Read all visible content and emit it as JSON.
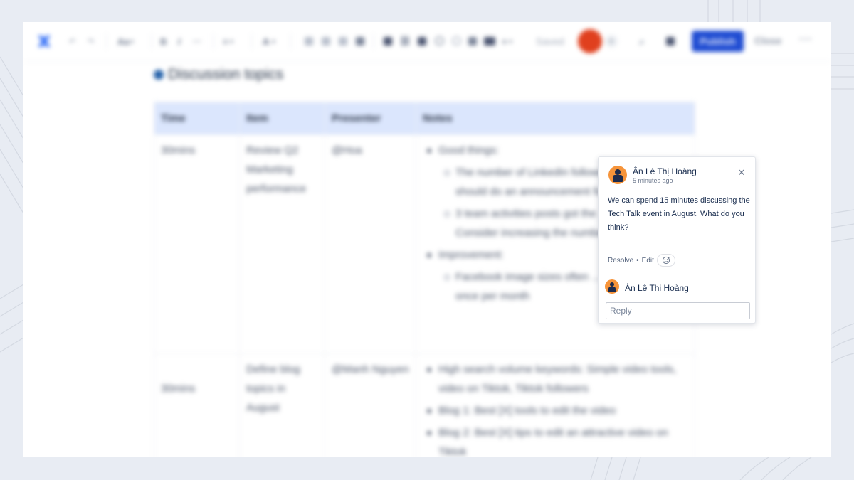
{
  "colors": {
    "brand": "#2f6cf6",
    "publish": "#1e4bd2",
    "header_row": "#dbe6fd",
    "avatar": "#f6943a",
    "presence_avatar": "#e0401e"
  },
  "toolbar": {
    "undo_redo_icons": [
      "undo-icon",
      "redo-icon"
    ],
    "text_style_label": "Aa",
    "format_icons": [
      "bold-icon",
      "italic-icon",
      "more-format-icon"
    ],
    "align_icon": "align-icon",
    "text_color_icon": "text-color-icon",
    "list_icons": [
      "bullet-list-icon",
      "numbered-list-icon",
      "task-list-icon",
      "indent-icon"
    ],
    "insert_icons": [
      "table-icon",
      "link-icon",
      "image-icon",
      "mention-icon",
      "emoji-icon",
      "layout-icon",
      "columns-icon",
      "insert-more-icon"
    ],
    "saved_label": "Saved",
    "add_collaborator": "+",
    "publish_label": "Publish",
    "close_label": "Close",
    "more_label": "···"
  },
  "document": {
    "section_title": "Discussion topics",
    "table": {
      "headers": [
        "Time",
        "Item",
        "Presenter",
        "Notes"
      ],
      "rows": [
        {
          "time": "30mins",
          "item": "Review Q2 Marketing performance",
          "presenter": "@Hoa",
          "notes": [
            {
              "text": "Good things:",
              "children": [
                "The number of LinkedIn followers … => We should do an announcement for this milestone.",
                "3 team activities posts got the … engagement => Consider increasing the number of these posts"
              ]
            },
            {
              "text": "Improvement:",
              "children": [
                "Facebook image sizes often … should update once per month"
              ]
            }
          ]
        },
        {
          "time": "30mins",
          "item": "Define blog topics in August",
          "presenter": "@Manh Nguyen",
          "notes": [
            {
              "text": "High search volume keywords: Simple video tools, video on Tiktok, Tiktok followers",
              "children": []
            },
            {
              "text": "Blog 1: Best [X] tools to edit the video",
              "children": []
            },
            {
              "text": "Blog 2: Best [X] tips to edit an attractive video on Tiktok",
              "children": []
            }
          ]
        }
      ]
    }
  },
  "comment": {
    "author": "Ân Lê Thị Hoàng",
    "time": "5 minutes ago",
    "body": "We can spend 15 minutes discussing the Tech Talk event in August. What do you think?",
    "resolve_label": "Resolve",
    "separator": "•",
    "edit_label": "Edit",
    "reply_author": "Ân Lê Thị Hoàng",
    "reply_placeholder": "Reply",
    "reply_value": ""
  }
}
